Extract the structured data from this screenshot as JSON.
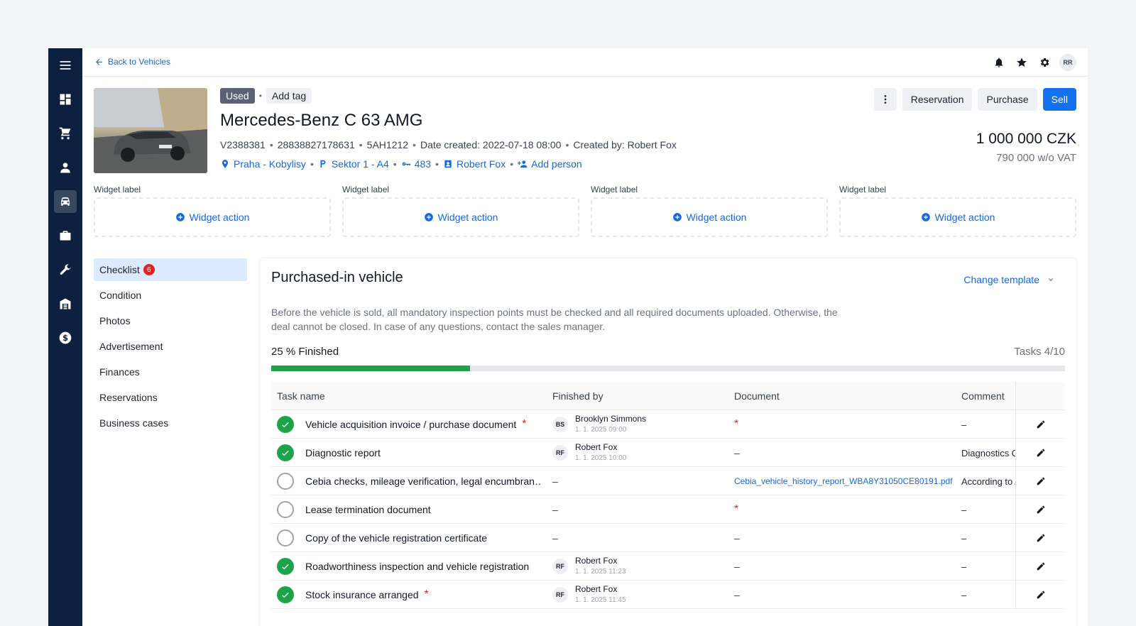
{
  "topbar": {
    "back_label": "Back to Vehicles",
    "avatar_initials": "RR"
  },
  "vehicle": {
    "tag_used": "Used",
    "tag_add": "Add tag",
    "title": "Mercedes-Benz C 63 AMG",
    "meta": [
      "V2388381",
      "28838827178631",
      "5AH1212",
      "Date created: 2022-07-18 08:00",
      "Created by: Robert Fox"
    ],
    "location": "Praha - Kobylisy",
    "sector": "Sektor 1 - A4",
    "key": "483",
    "person": "Robert Fox",
    "add_person": "Add person",
    "price": "1 000 000 CZK",
    "price_no_vat": "790 000 w/o VAT"
  },
  "actions": {
    "reservation": "Reservation",
    "purchase": "Purchase",
    "sell": "Sell"
  },
  "widgets": [
    {
      "label": "Widget label",
      "action": "Widget action"
    },
    {
      "label": "Widget label",
      "action": "Widget action"
    },
    {
      "label": "Widget label",
      "action": "Widget action"
    },
    {
      "label": "Widget label",
      "action": "Widget action"
    }
  ],
  "side_nav": [
    {
      "label": "Checklist",
      "badge": "6"
    },
    {
      "label": "Condition"
    },
    {
      "label": "Photos"
    },
    {
      "label": "Advertisement"
    },
    {
      "label": "Finances"
    },
    {
      "label": "Reservations"
    },
    {
      "label": "Business cases"
    }
  ],
  "panel": {
    "title": "Purchased-in vehicle",
    "change_template": "Change template",
    "description": "Before the vehicle is sold, all mandatory inspection points must be checked and all required documents uploaded. Otherwise, the deal cannot be closed. In case of any questions, contact the sales manager.",
    "progress_label": "25 % Finished",
    "progress_value": 0.25,
    "tasks_count": "Tasks 4/10"
  },
  "table": {
    "headers": {
      "task": "Task name",
      "finished": "Finished by",
      "document": "Document",
      "comment": "Comment"
    },
    "rows": [
      {
        "done": true,
        "name": "Vehicle acquisition invoice / purchase document",
        "required": true,
        "initials": "BS",
        "user": "Brooklyn Simmons",
        "date": "1. 1. 2025 09:00",
        "doc": "",
        "doc_required": true,
        "comment": "–"
      },
      {
        "done": true,
        "name": "Diagnostic report",
        "required": false,
        "initials": "RF",
        "user": "Robert Fox",
        "date": "1. 1. 2025 10:00",
        "doc": "–",
        "doc_required": false,
        "comment": "Diagnostics OK"
      },
      {
        "done": false,
        "name": "Cebia checks, mileage verification, legal encumbran…",
        "required": false,
        "initials": "",
        "user": "–",
        "date": "",
        "doc": "Cebia_vehicle_history_report_WBA8Y31050CE80191.pdf",
        "doc_required": false,
        "doc_link": true,
        "comment": "According to A"
      },
      {
        "done": false,
        "name": "Lease termination document",
        "required": false,
        "initials": "",
        "user": "–",
        "date": "",
        "doc": "",
        "doc_required": true,
        "comment": "–"
      },
      {
        "done": false,
        "name": "Copy of the vehicle registration certificate",
        "required": false,
        "initials": "",
        "user": "–",
        "date": "",
        "doc": "–",
        "doc_required": false,
        "comment": "–"
      },
      {
        "done": true,
        "name": "Roadworthiness inspection and vehicle registration",
        "required": false,
        "initials": "RF",
        "user": "Robert Fox",
        "date": "1. 1. 2025 11:23",
        "doc": "–",
        "doc_required": false,
        "comment": "–"
      },
      {
        "done": true,
        "name": "Stock insurance arranged",
        "required": true,
        "initials": "RF",
        "user": "Robert Fox",
        "date": "1. 1. 2025 11:45",
        "doc": "–",
        "doc_required": false,
        "comment": "–"
      }
    ]
  }
}
